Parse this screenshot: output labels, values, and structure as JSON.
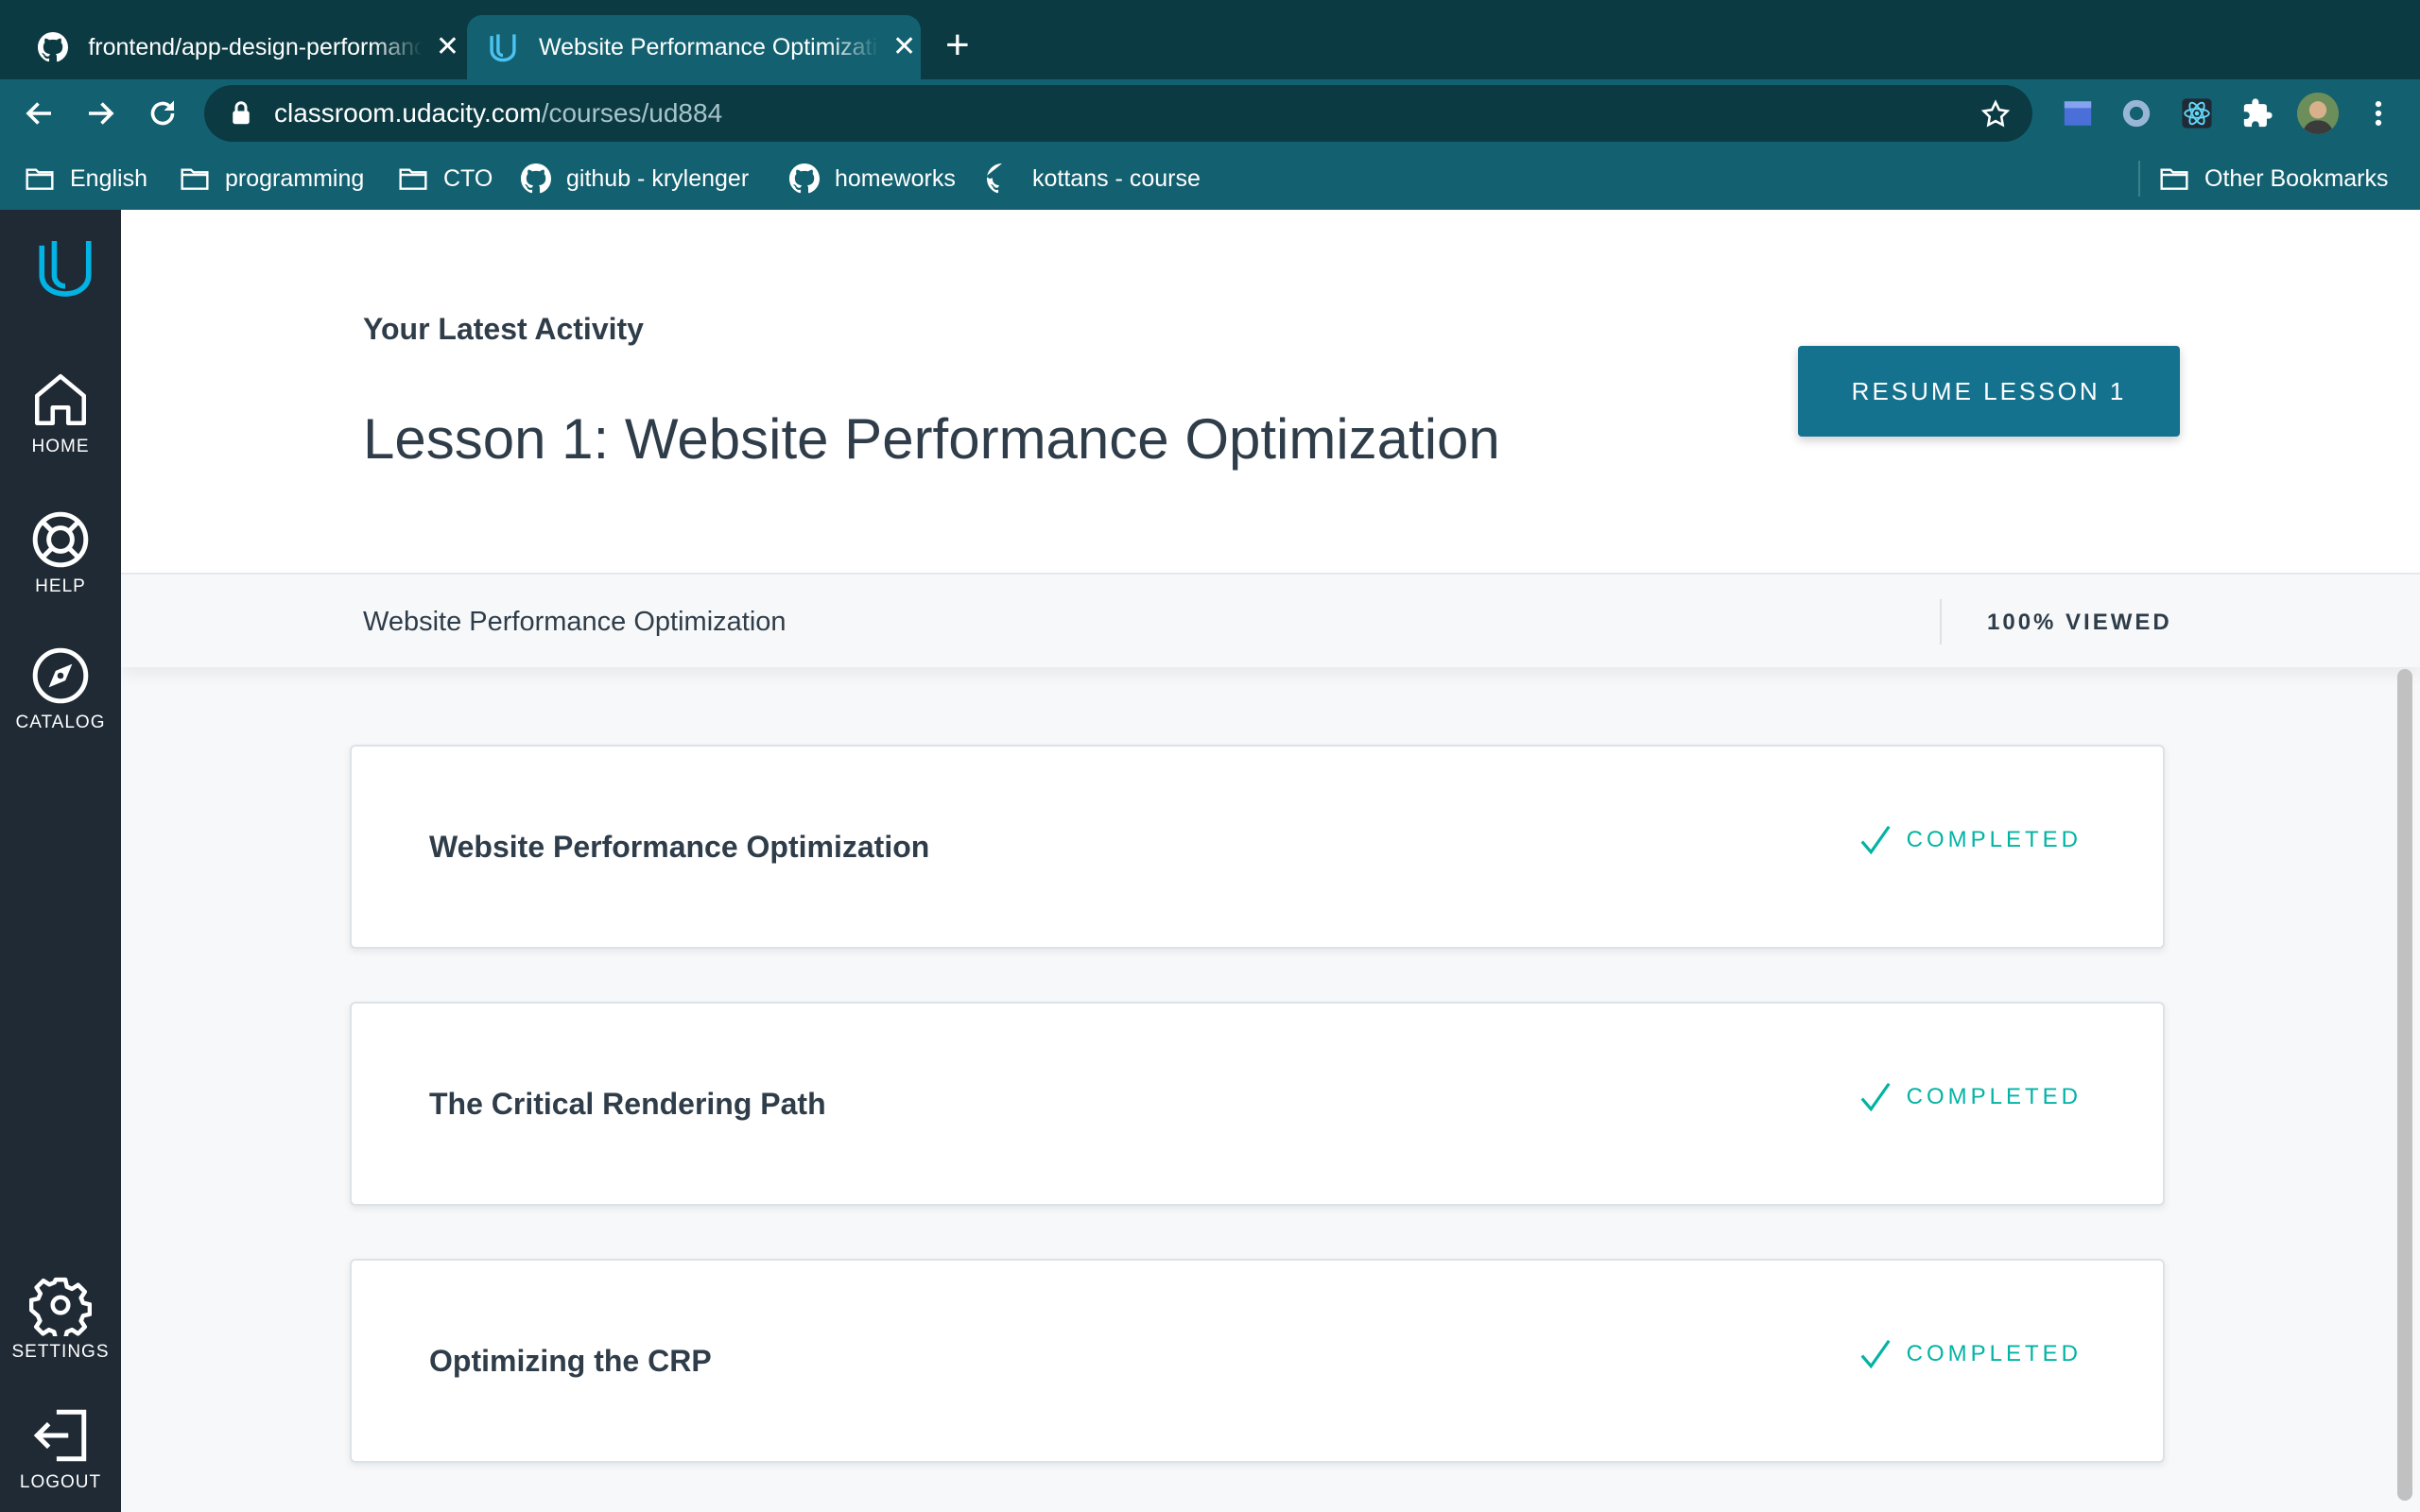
{
  "browser": {
    "tabs": [
      {
        "title": "frontend/app-design-performance",
        "icon": "github-icon",
        "active": false
      },
      {
        "title": "Website Performance Optimization",
        "icon": "udacity-icon",
        "active": true
      }
    ],
    "url_host": "classroom.udacity.com",
    "url_path": "/courses/ud884",
    "bookmarks": [
      {
        "label": "English",
        "icon": "folder-icon"
      },
      {
        "label": "programming",
        "icon": "folder-icon"
      },
      {
        "label": "CTO",
        "icon": "folder-icon"
      },
      {
        "label": "github - krylenger",
        "icon": "github-icon"
      },
      {
        "label": "homeworks",
        "icon": "github-icon"
      },
      {
        "label": "kottans - course",
        "icon": "github-icon"
      }
    ],
    "other_bookmarks": "Other Bookmarks"
  },
  "sidebar": {
    "items": [
      {
        "label": "HOME",
        "icon": "home-icon"
      },
      {
        "label": "HELP",
        "icon": "help-lifebuoy-icon"
      },
      {
        "label": "CATALOG",
        "icon": "compass-icon"
      },
      {
        "label": "SETTINGS",
        "icon": "gear-icon"
      },
      {
        "label": "LOGOUT",
        "icon": "logout-icon"
      }
    ]
  },
  "hero": {
    "latest_label": "Your Latest Activity",
    "lesson_title": "Lesson 1: Website Performance Optimization",
    "resume_button": "RESUME LESSON 1"
  },
  "subbar": {
    "title": "Website Performance Optimization",
    "viewed": "100% VIEWED"
  },
  "concepts": [
    {
      "title": "Website Performance Optimization",
      "status": "COMPLETED"
    },
    {
      "title": "The Critical Rendering Path",
      "status": "COMPLETED"
    },
    {
      "title": "Optimizing the CRP",
      "status": "COMPLETED"
    }
  ],
  "colors": {
    "accent": "#15728f",
    "completed": "#02b3a4",
    "sidebar": "#1f2a35",
    "chrome": "#136170"
  }
}
